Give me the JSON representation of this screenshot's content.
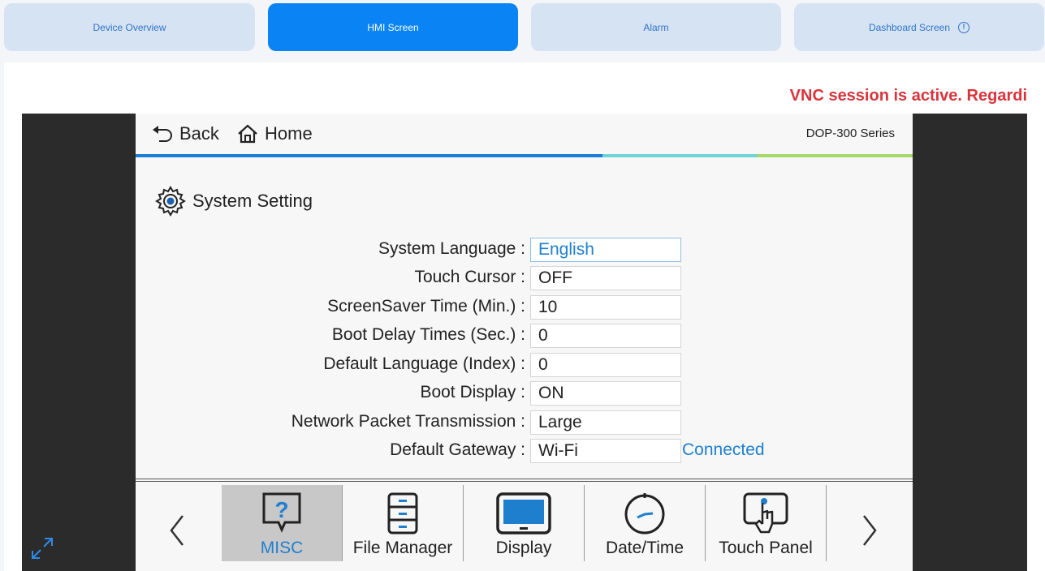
{
  "tabs": [
    {
      "label": "Device Overview",
      "active": false
    },
    {
      "label": "HMI Screen",
      "active": true
    },
    {
      "label": "Alarm",
      "active": false
    },
    {
      "label": "Dashboard Screen",
      "active": false,
      "icon": "info-icon"
    }
  ],
  "vnc_message": "VNC session is active. Regardi",
  "hmi": {
    "back_label": "Back",
    "home_label": "Home",
    "series": "DOP-300 Series",
    "section_title": "System Setting",
    "settings": [
      {
        "label": "System Language :",
        "value": "English",
        "selected": true
      },
      {
        "label": "Touch Cursor :",
        "value": "OFF"
      },
      {
        "label": "ScreenSaver Time (Min.) :",
        "value": "10"
      },
      {
        "label": "Boot Delay Times (Sec.) :",
        "value": "0"
      },
      {
        "label": "Default Language (Index) :",
        "value": "0"
      },
      {
        "label": "Boot Display :",
        "value": "ON"
      },
      {
        "label": "Network Packet Transmission :",
        "value": "Large"
      },
      {
        "label": "Default Gateway :",
        "value": "Wi-Fi",
        "status": "Connected"
      }
    ],
    "nav": [
      {
        "label": "MISC",
        "icon": "question-bubble-icon",
        "active": true
      },
      {
        "label": "File Manager",
        "icon": "cabinet-icon"
      },
      {
        "label": "Display",
        "icon": "monitor-icon"
      },
      {
        "label": "Date/Time",
        "icon": "clock-icon"
      },
      {
        "label": "Touch Panel",
        "icon": "touch-hand-icon"
      }
    ]
  },
  "colors": {
    "accent": "#0a84f5",
    "tab_bg": "#d6e3f3",
    "alert": "#d9343b",
    "link": "#1f7fcf",
    "bar_blue": "#1a7fd6",
    "bar_cyan": "#6fd3d9",
    "bar_green": "#a6d86a"
  }
}
